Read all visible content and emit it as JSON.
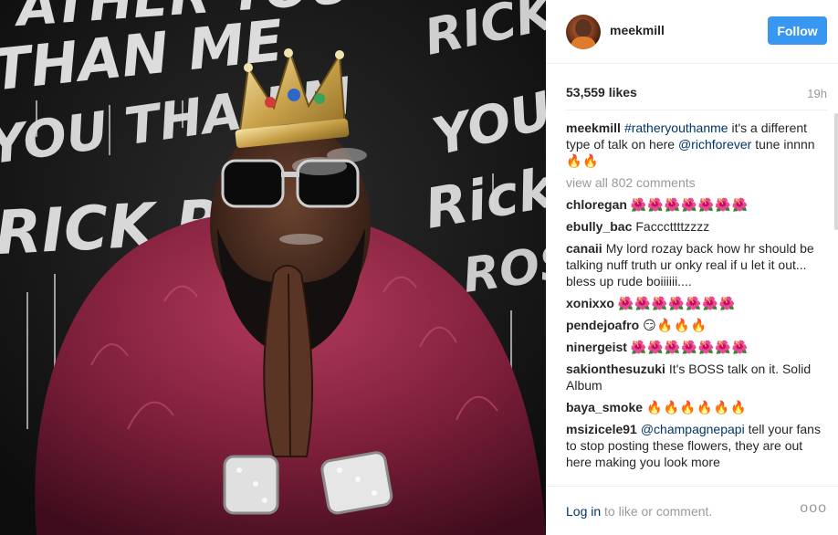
{
  "post": {
    "username": "meekmill",
    "follow_label": "Follow",
    "likes": "53,559 likes",
    "time": "19h",
    "caption": {
      "user": "meekmill",
      "hashtag": "#ratheryouthanme",
      "text1": " it's a different type of talk on here ",
      "mention": "@richforever",
      "text2": " tune innnn",
      "emoji": "🔥🔥"
    },
    "view_all": "view all 802 comments",
    "comments": [
      {
        "user": "chloregan",
        "text": "🌺🌺🌺🌺🌺🌺🌺"
      },
      {
        "user": "ebully_bac",
        "text": "Facccttttzzzz"
      },
      {
        "user": "canaii",
        "text": "My lord rozay back how hr should be talking nuff truth ur onky real if u let it out... bless up rude boiiiiii...."
      },
      {
        "user": "xonixxo",
        "text": "🌺🌺🌺🌺🌺🌺🌺"
      },
      {
        "user": "pendejoafro",
        "text": "😏🔥🔥🔥"
      },
      {
        "user": "ninergeist",
        "text": "🌺🌺🌺🌺🌺🌺🌺"
      },
      {
        "user": "sakionthesuzuki",
        "text": "It's BOSS talk on it. Solid Album"
      },
      {
        "user": "baya_smoke",
        "text": "🔥🔥🔥🔥🔥🔥"
      }
    ],
    "last_comment": {
      "user": "msizicele91",
      "mention": "@champagnepapi",
      "text": " tell your fans to stop posting these flowers, they are out here making you look more"
    },
    "footer": {
      "login_link": "Log in",
      "login_rest": " to like or comment.",
      "more_icon": "ooo"
    }
  },
  "image": {
    "alt_subject": "rick-ross-album-cover",
    "graffiti_words": [
      "ATHER YOU",
      "THAN ME",
      "YOU THAN M",
      "RICK ROS",
      "RICK ROSS",
      "YOU TH",
      "Rick",
      "ROS"
    ]
  },
  "colors": {
    "accent": "#3897f0",
    "link": "#003569",
    "muted": "#999999"
  }
}
